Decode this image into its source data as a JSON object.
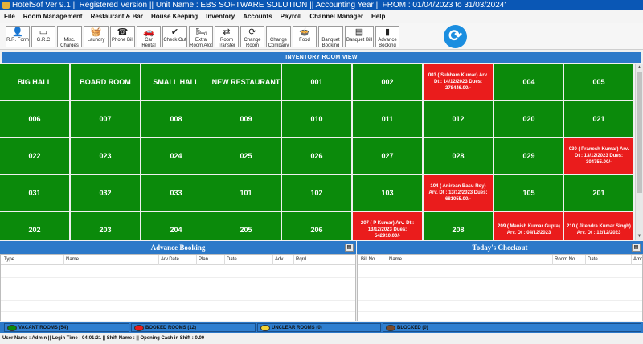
{
  "window": {
    "title": "HotelSof Ver 9.1 ||  Registered Version ||      Unit Name : EBS SOFTWARE SOLUTION      || Accounting Year ||  FROM : 01/04/2023 to 31/03/2024'"
  },
  "menu": [
    "File",
    "Room Management",
    "Restaurant & Bar",
    "House Keeping",
    "Inventory",
    "Accounts",
    "Payroll",
    "Channel Manager",
    "Help"
  ],
  "toolbar": [
    {
      "label": "R.R. Form",
      "icon": "👤",
      "name": "rr-form"
    },
    {
      "label": "G.R.C",
      "icon": "▭",
      "name": "grc"
    },
    {
      "label": "Misc. Charges",
      "icon": "",
      "name": "misc-charges"
    },
    {
      "label": "Laundry",
      "icon": "🧺",
      "name": "laundry"
    },
    {
      "label": "Phone Bill",
      "icon": "☎",
      "name": "phone-bill"
    },
    {
      "label": "Car Rental",
      "icon": "🚗",
      "name": "car-rental"
    },
    {
      "label": "Check Out",
      "icon": "✔",
      "name": "check-out"
    },
    {
      "label": "Extra Room Alot",
      "icon": "🛏",
      "name": "extra-room-alot"
    },
    {
      "label": "Room Transfer",
      "icon": "⇄",
      "name": "room-transfer"
    },
    {
      "label": "Change Room",
      "icon": "⟳",
      "name": "change-room"
    },
    {
      "label": "Change Company",
      "icon": "",
      "name": "change-company"
    },
    {
      "label": "Food",
      "icon": "🍲",
      "name": "food"
    },
    {
      "label": "Banquet Booking",
      "icon": "",
      "name": "banquet-booking"
    },
    {
      "label": "Banquet Bill",
      "icon": "▤",
      "name": "banquet-bill"
    },
    {
      "label": "Advance Booking",
      "icon": "▮",
      "name": "advance-booking"
    }
  ],
  "inventory_header": "INVENTORY ROOM VIEW",
  "rooms": [
    {
      "label": "BIG HALL",
      "status": "vacant"
    },
    {
      "label": "BOARD ROOM",
      "status": "vacant"
    },
    {
      "label": "SMALL HALL",
      "status": "vacant"
    },
    {
      "label": "NEW RESTAURANT",
      "status": "vacant"
    },
    {
      "label": "001",
      "status": "vacant"
    },
    {
      "label": "002",
      "status": "vacant"
    },
    {
      "label": "003 ( Subham Kumar) Arv. Dt : 14/12/2023 Dues: 278446.00/-",
      "status": "booked"
    },
    {
      "label": "004",
      "status": "vacant"
    },
    {
      "label": "005",
      "status": "vacant"
    },
    {
      "label": "006",
      "status": "vacant"
    },
    {
      "label": "007",
      "status": "vacant"
    },
    {
      "label": "008",
      "status": "vacant"
    },
    {
      "label": "009",
      "status": "vacant"
    },
    {
      "label": "010",
      "status": "vacant"
    },
    {
      "label": "011",
      "status": "vacant"
    },
    {
      "label": "012",
      "status": "vacant"
    },
    {
      "label": "020",
      "status": "vacant"
    },
    {
      "label": "021",
      "status": "vacant"
    },
    {
      "label": "022",
      "status": "vacant"
    },
    {
      "label": "023",
      "status": "vacant"
    },
    {
      "label": "024",
      "status": "vacant"
    },
    {
      "label": "025",
      "status": "vacant"
    },
    {
      "label": "026",
      "status": "vacant"
    },
    {
      "label": "027",
      "status": "vacant"
    },
    {
      "label": "028",
      "status": "vacant"
    },
    {
      "label": "029",
      "status": "vacant"
    },
    {
      "label": "030 ( Pranesh Kumar) Arv. Dt : 13/12/2023 Dues: 304755.00/-",
      "status": "booked"
    },
    {
      "label": "031",
      "status": "vacant"
    },
    {
      "label": "032",
      "status": "vacant"
    },
    {
      "label": "033",
      "status": "vacant"
    },
    {
      "label": "101",
      "status": "vacant"
    },
    {
      "label": "102",
      "status": "vacant"
    },
    {
      "label": "103",
      "status": "vacant"
    },
    {
      "label": "104 ( Anirban Basu Roy) Arv. Dt : 13/12/2023 Dues: 681055.00/-",
      "status": "booked"
    },
    {
      "label": "105",
      "status": "vacant"
    },
    {
      "label": "201",
      "status": "vacant"
    },
    {
      "label": "202",
      "status": "vacant"
    },
    {
      "label": "203",
      "status": "vacant"
    },
    {
      "label": "204",
      "status": "vacant"
    },
    {
      "label": "205",
      "status": "vacant"
    },
    {
      "label": "206",
      "status": "vacant"
    },
    {
      "label": "207 ( P Kumar) Arv. Dt : 13/12/2023 Dues: 542910.00/-",
      "status": "booked"
    },
    {
      "label": "208",
      "status": "vacant"
    },
    {
      "label": "209 ( Manish Kumar Gupta) Arv. Dt : 04/12/2023",
      "status": "booked"
    },
    {
      "label": "210 ( Jitendra Kumar Singh) Arv. Dt : 12/12/2023",
      "status": "booked"
    }
  ],
  "advance_booking": {
    "title": "Advance Booking",
    "columns": [
      "Type",
      "Name",
      "Arv.Date",
      "Plan",
      "Date",
      "Adv.",
      "Rqrd"
    ]
  },
  "checkout": {
    "title": "Today's Checkout",
    "columns": [
      "Bill No",
      "Name",
      "Room No",
      "Date",
      "Amou"
    ]
  },
  "legend": [
    {
      "label": "VACANT ROOMS (54)",
      "color": "#0b8a0b"
    },
    {
      "label": "BOOKED ROOMS (12)",
      "color": "#ea1c1c"
    },
    {
      "label": "UNCLEAR ROOMS (0)",
      "color": "#f2d233"
    },
    {
      "label": "BLOCKED (0)",
      "color": "#7a4a2a"
    }
  ],
  "status": "User Name : Admin  || Login Time : 04:01:21  ||  Shift Name :  || Opening Cash in Shift : 0.00"
}
